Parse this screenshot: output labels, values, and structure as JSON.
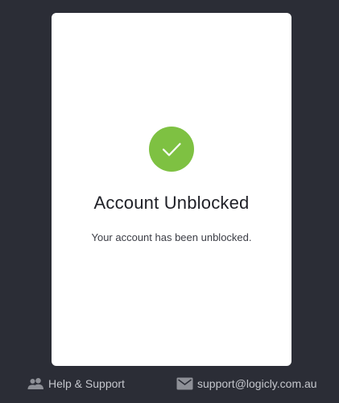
{
  "dialog": {
    "status_icon": "checkmark-circle-icon",
    "status_color": "#7ec142",
    "title": "Account Unblocked",
    "message": "Your account has been unblocked."
  },
  "footer": {
    "help": {
      "icon": "people-icon",
      "label": "Help & Support"
    },
    "email": {
      "icon": "envelope-icon",
      "label": "support@logicly.com.au"
    }
  },
  "colors": {
    "background": "#2b2d36",
    "card": "#ffffff",
    "accent": "#7ec142",
    "footer_text": "#c5c7cd"
  }
}
